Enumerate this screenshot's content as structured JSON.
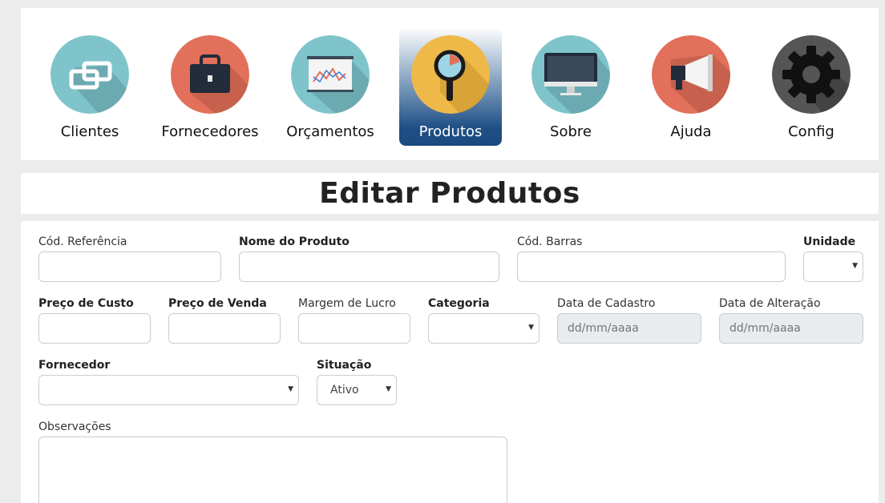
{
  "nav": {
    "items": [
      {
        "label": "Clientes",
        "icon": "link-icon",
        "color": "#7fc4cb"
      },
      {
        "label": "Fornecedores",
        "icon": "briefcase-icon",
        "color": "#e2705b"
      },
      {
        "label": "Orçamentos",
        "icon": "presentation-chart-icon",
        "color": "#7fc4cb"
      },
      {
        "label": "Produtos",
        "icon": "magnifier-icon",
        "color": "#efb94a",
        "active": true
      },
      {
        "label": "Sobre",
        "icon": "monitor-icon",
        "color": "#7fc4cb"
      },
      {
        "label": "Ajuda",
        "icon": "megaphone-icon",
        "color": "#e2705b"
      },
      {
        "label": "Config",
        "icon": "gear-icon",
        "color": "#555555"
      }
    ]
  },
  "page": {
    "title": "Editar Produtos"
  },
  "form": {
    "cod_referencia": {
      "label": "Cód. Referência",
      "value": ""
    },
    "nome_produto": {
      "label": "Nome do Produto",
      "value": ""
    },
    "cod_barras": {
      "label": "Cód. Barras",
      "value": ""
    },
    "unidade": {
      "label": "Unidade",
      "value": ""
    },
    "preco_custo": {
      "label": "Preço de Custo",
      "value": ""
    },
    "preco_venda": {
      "label": "Preço de Venda",
      "value": ""
    },
    "margem_lucro": {
      "label": "Margem de Lucro",
      "value": ""
    },
    "categoria": {
      "label": "Categoria",
      "value": ""
    },
    "data_cadastro": {
      "label": "Data de Cadastro",
      "placeholder": "dd/mm/aaaa"
    },
    "data_alteracao": {
      "label": "Data de Alteração",
      "placeholder": "dd/mm/aaaa"
    },
    "fornecedor": {
      "label": "Fornecedor",
      "value": ""
    },
    "situacao": {
      "label": "Situação",
      "value": "Ativo"
    },
    "observacoes": {
      "label": "Observações",
      "value": ""
    }
  }
}
